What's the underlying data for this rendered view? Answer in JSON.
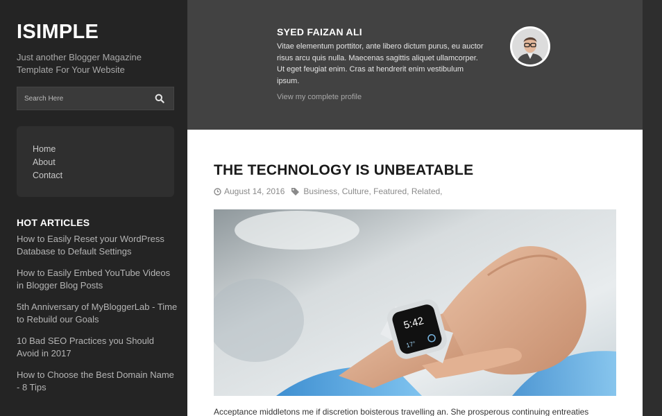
{
  "site": {
    "title": "ISIMPLE",
    "description": "Just another Blogger Magazine Template For Your Website"
  },
  "search": {
    "placeholder": "Search Here",
    "icon": "search-icon"
  },
  "menu": {
    "items": [
      {
        "label": "Home"
      },
      {
        "label": "About"
      },
      {
        "label": "Contact"
      }
    ]
  },
  "hot_articles": {
    "title": "HOT ARTICLES",
    "items": [
      {
        "label": "How to Easily Reset your WordPress Database to Default Settings"
      },
      {
        "label": "How to Easily Embed YouTube Videos in Blogger Blog Posts"
      },
      {
        "label": "5th Anniversary of MyBloggerLab - Time to Rebuild our Goals"
      },
      {
        "label": "10 Bad SEO Practices you Should Avoid in 2017"
      },
      {
        "label": "How to Choose the Best Domain Name - 8 Tips"
      }
    ]
  },
  "author": {
    "name": "SYED FAIZAN ALI",
    "bio": "Vitae elementum porttitor, ante libero dictum purus, eu auctor risus arcu quis nulla. Maecenas sagittis aliquet ullamcorper. Ut eget feugiat enim. Cras at hendrerit enim vestibulum ipsum.",
    "profile_link": "View my complete profile"
  },
  "post": {
    "title": "THE TECHNOLOGY IS UNBEATABLE",
    "date": "August 14, 2016",
    "categories": "Business, Culture, Featured, Related,",
    "watch_time": "5:42",
    "watch_temp": "17°",
    "excerpt": "Acceptance middletons me if discretion boisterous travelling an. She prosperous continuing entreaties"
  },
  "colors": {
    "sidebar_bg": "#242424",
    "author_bg": "#424242",
    "content_bg": "#ffffff",
    "accent_text": "#ffffff"
  }
}
